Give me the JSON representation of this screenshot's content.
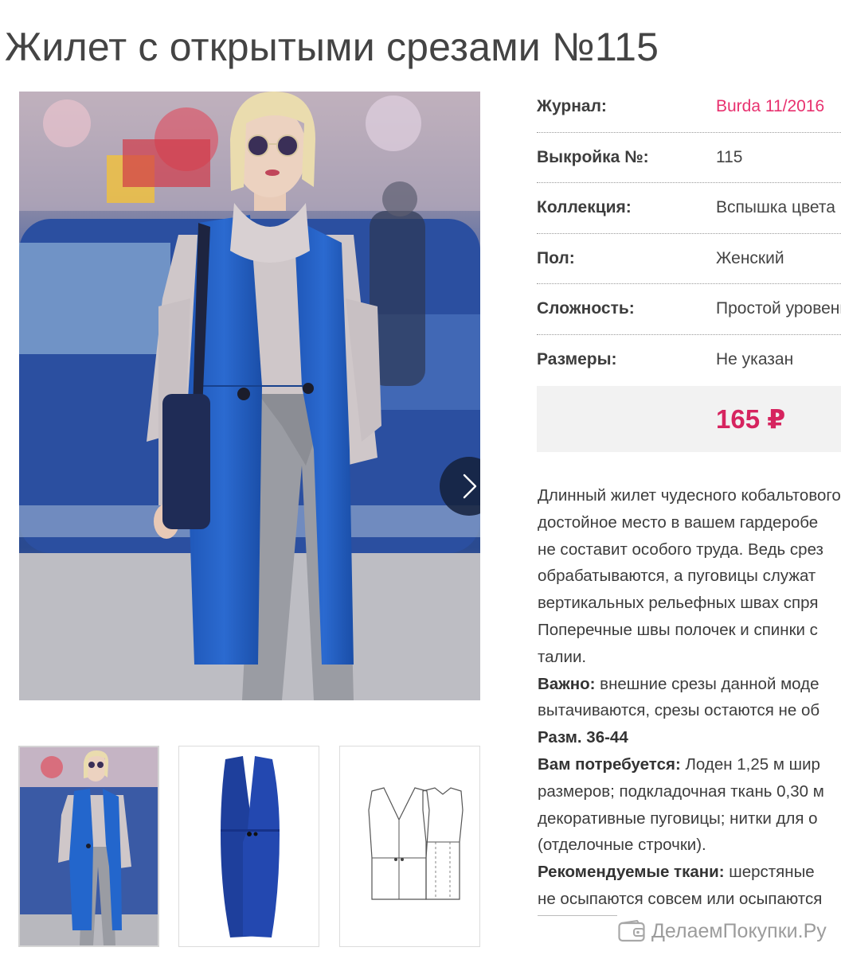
{
  "page": {
    "title": "Жилет с открытыми срезами №115"
  },
  "gallery": {
    "next_icon": "chevron-right-icon",
    "thumbnails": [
      "photo",
      "front-view",
      "technical-drawing"
    ]
  },
  "info": {
    "rows": [
      {
        "label": "Журнал:",
        "value": "Burda 11/2016"
      },
      {
        "label": "Выкройка №:",
        "value": "115"
      },
      {
        "label": "Коллекция:",
        "value": "Вспышка цвета"
      },
      {
        "label": "Пол:",
        "value": "Женский"
      },
      {
        "label": "Сложность:",
        "value": "Простой уровень"
      },
      {
        "label": "Размеры:",
        "value": "Не указан"
      }
    ],
    "link_color": "#e8316f"
  },
  "price": {
    "value": "165 ₽",
    "color": "#d6245f"
  },
  "description": {
    "lines": [
      "Длинный жилет чудесного кобальтового",
      "достойное место в вашем гардеробе",
      "не составит особого труда. Ведь срез",
      "обрабатываются, а пуговицы служат",
      "вертикальных рельефных швах спря",
      "Поперечные швы полочек и спинки с",
      "талии."
    ],
    "important_label": "Важно:",
    "important_lines": [
      " внешние срезы данной моде",
      "вытачиваются, срезы остаются не об"
    ],
    "sizes": "Разм. 36-44",
    "needed_label": "Вам потребуется:",
    "needed_lines": [
      " Лоден 1,25 м шир",
      "размеров; подкладочная ткань 0,30 м",
      "декоративные пуговицы; нитки для о",
      "(отделочные строчки)."
    ],
    "fabrics_label": "Рекомендуемые ткани:",
    "fabrics_lines": [
      " шерстяные",
      "не осыпаются совсем или осыпаются"
    ]
  },
  "watermark": {
    "text": "ДелаемПокупки.Ру",
    "icon": "wallet-icon"
  }
}
